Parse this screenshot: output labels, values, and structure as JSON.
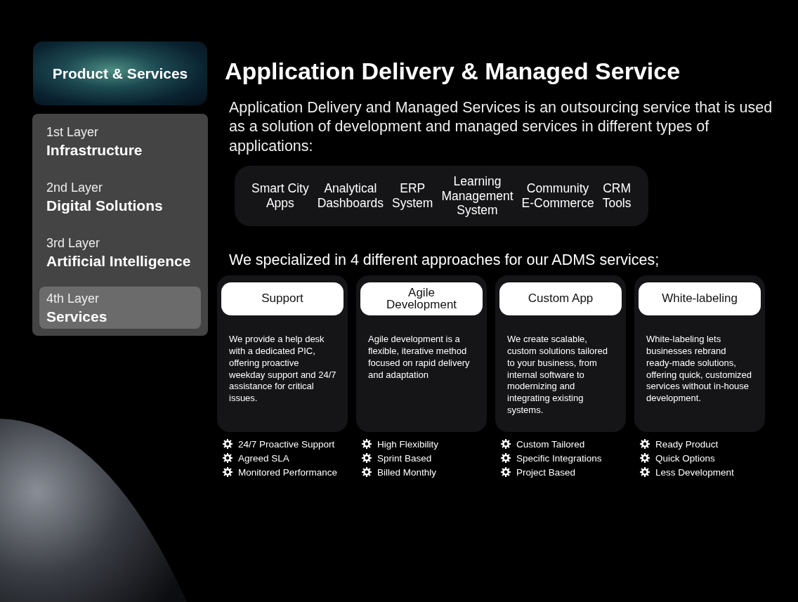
{
  "sidebar": {
    "header": "Product & Services",
    "items": [
      {
        "layer": "1st Layer",
        "title": "Infrastructure",
        "selected": false
      },
      {
        "layer": "2nd Layer",
        "title": "Digital Solutions",
        "selected": false
      },
      {
        "layer": "3rd Layer",
        "title": "Artificial Intelligence",
        "selected": false
      },
      {
        "layer": "4th Layer",
        "title": "Services",
        "selected": true
      }
    ]
  },
  "title": "Application Delivery & Managed Service",
  "description": "Application Delivery and Managed Services is an outsourcing service that is used as a solution of development and managed services in different types of applications:",
  "applications": [
    "Smart City\nApps",
    "Analytical\nDashboards",
    "ERP\nSystem",
    "Learning\nManagement\nSystem",
    "Community\nE-Commerce",
    "CRM\nTools"
  ],
  "approaches_intro": "We specialized in 4 different approaches for our ADMS services;",
  "approaches": [
    {
      "name": "Support",
      "text": "We provide a help desk with a dedicated PIC, offering proactive weekday support and 24/7 assistance for critical issues.",
      "features": [
        "24/7 Proactive Support",
        "Agreed SLA",
        "Monitored Performance"
      ]
    },
    {
      "name": "Agile\nDevelopment",
      "text": "Agile development is a flexible, iterative method focused on rapid delivery and adaptation",
      "features": [
        "High Flexibility",
        "Sprint Based",
        "Billed Monthly"
      ]
    },
    {
      "name": "Custom App",
      "text": "We create scalable, custom solutions tailored to your business, from internal software to modernizing and integrating existing systems.",
      "features": [
        "Custom Tailored",
        "Specific Integrations",
        "Project Based"
      ]
    },
    {
      "name": "White-labeling",
      "text": "White-labeling lets businesses rebrand ready-made solutions, offering quick, customized services without in-house development.",
      "features": [
        "Ready Product",
        "Quick Options",
        "Less Development"
      ]
    }
  ]
}
